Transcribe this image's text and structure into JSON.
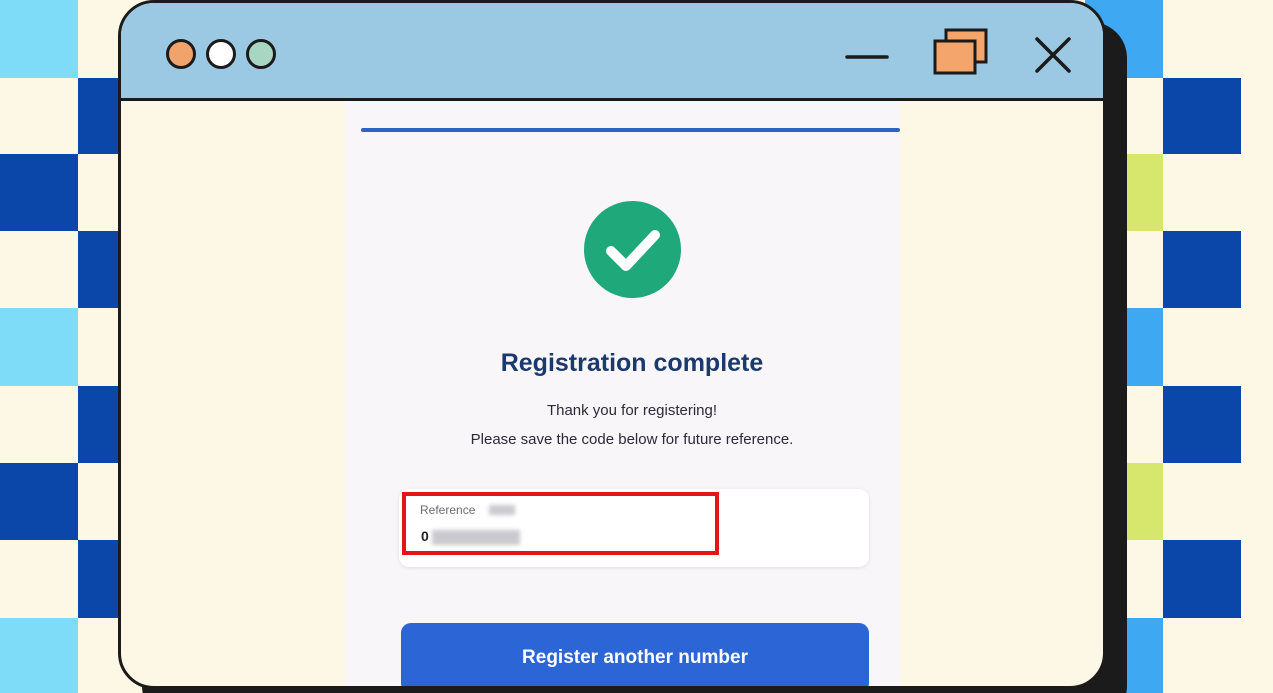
{
  "colors": {
    "background": "#fdf7e6",
    "titlebar": "#9bc8e2",
    "outline": "#1b1b1b",
    "dot_orange": "#f0a36b",
    "dot_white": "#ffffff",
    "dot_green": "#a7d7c2",
    "restore_icon_fill": "#f3a56c",
    "checker_dark_blue": "#0a47a8",
    "checker_light_blue": "#7fdcf8",
    "checker_lime": "#d7e76e",
    "checker_sky": "#3ea8f2",
    "progress": "#2c66c4",
    "success_green": "#1fa97a",
    "heading": "#1a3a6e",
    "highlight_red": "#e3141a",
    "button_blue": "#2c66d6"
  },
  "window": {
    "controls": {
      "minimize_icon": "minus-icon",
      "maximize_icon": "restore-window-icon",
      "close_icon": "close-x-icon"
    }
  },
  "registration": {
    "status_icon": "check-circle-icon",
    "title": "Registration complete",
    "message_line1": "Thank you for registering!",
    "message_line2": "Please save the code below for future reference.",
    "reference": {
      "label": "Reference",
      "value_prefix": "0"
    },
    "button_label": "Register another number"
  }
}
